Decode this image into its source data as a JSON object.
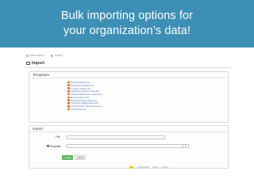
{
  "banner": {
    "line1": "Bulk importing options for",
    "line2": "your organization’s data!"
  },
  "topnav": {
    "items": [
      {
        "label": "Add record"
      },
      {
        "label": "Import"
      }
    ]
  },
  "page": {
    "title": "Import"
  },
  "templates": {
    "title": "Templates",
    "items": [
      "Building Master.xlsx",
      "Department Master.xlsx",
      "Location Master.xlsx",
      "Warehouse Master Data.xlsx",
      "Planned Maintenance Data.xlsx",
      "Reserve Items.xlsx",
      "Schedule Master Data.xlsx",
      "Technician Master Data.xlsx",
      "Transportation Master Data.xlsx",
      "Unit Master.xlsx"
    ]
  },
  "import": {
    "title": "Import",
    "file_label": "File",
    "file_value": "",
    "template_label": "Template",
    "template_value": ""
  },
  "buttons": {
    "save": "Save",
    "back": "Back"
  },
  "footer": {
    "copyright": "© 2016 FMS",
    "terms": "Terms",
    "privacy": "Privacy"
  },
  "colors": {
    "banner": "#3d8fb5",
    "save_button": "#5cb85c",
    "template_link": "#5577bb",
    "excel_icon": "#e07a2e"
  }
}
